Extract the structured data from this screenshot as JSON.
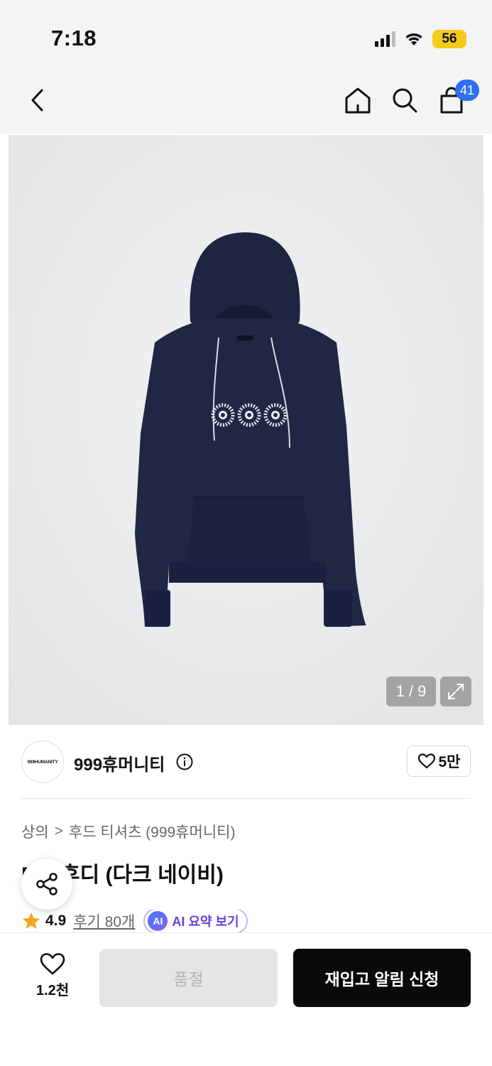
{
  "status_bar": {
    "time": "7:18",
    "battery": "56"
  },
  "nav": {
    "cart_count": "41"
  },
  "gallery": {
    "counter": "1 / 9"
  },
  "brand": {
    "logo_text": "999HUMANITY",
    "name": "999휴머니티",
    "likes": "5만"
  },
  "breadcrumb": {
    "category": "상의",
    "separator": ">",
    "subcategory": "후드 티셔츠 (999휴머니티)"
  },
  "product": {
    "title": "D... 후디 (다크 네이비)"
  },
  "rating": {
    "score": "4.9",
    "reviews": "후기 80개",
    "ai_badge": "AI",
    "ai_summary": "AI 요약 보기"
  },
  "bottom_bar": {
    "wish_count": "1.2천",
    "soldout_label": "품절",
    "restock_label": "재입고 알림 신청"
  },
  "colors": {
    "accent_blue": "#2f6ff0",
    "star": "#f5a623",
    "ai_purple": "#6b3ee0",
    "cta_black": "#0a0a0a",
    "battery_yellow": "#f4cb1b"
  }
}
